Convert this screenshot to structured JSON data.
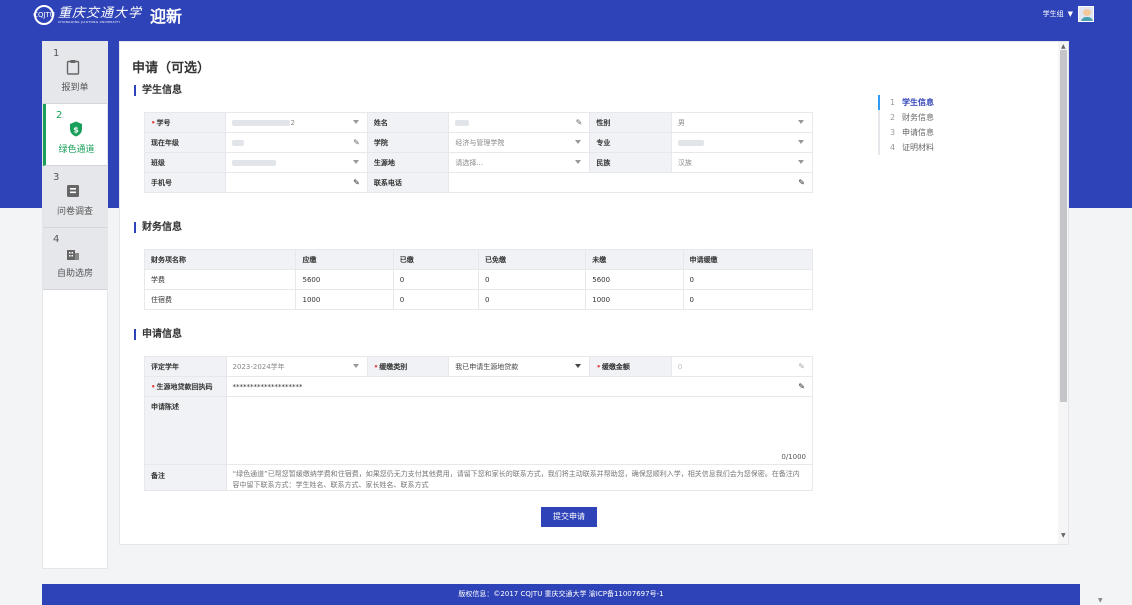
{
  "header": {
    "school_seal": "CQJTU",
    "school_name": "重庆交通大学",
    "school_name_en": "CHONGQING JIAOTONG UNIVERSITY",
    "app_title": "迎新",
    "user_label": "学生组"
  },
  "steps": [
    {
      "num": "1",
      "label": "报到单",
      "icon": "clipboard-icon",
      "active": false
    },
    {
      "num": "2",
      "label": "绿色通道",
      "icon": "shield-dollar-icon",
      "active": true
    },
    {
      "num": "3",
      "label": "问卷调查",
      "icon": "survey-icon",
      "active": false
    },
    {
      "num": "4",
      "label": "自助选房",
      "icon": "building-icon",
      "active": false
    }
  ],
  "main": {
    "title": "申请（可选）"
  },
  "student": {
    "section_title": "学生信息",
    "labels": {
      "id": "学号",
      "name": "姓名",
      "gender": "性别",
      "grade": "现在年级",
      "college": "学院",
      "major": "专业",
      "class": "班级",
      "origin": "生源地",
      "ethnic": "民族",
      "mobile": "手机号",
      "contact": "联系电话"
    },
    "values": {
      "id": "2",
      "gender": "男",
      "college": "经济与管理学院",
      "origin_placeholder": "请选择...",
      "ethnic": "汉族"
    }
  },
  "finance": {
    "section_title": "财务信息",
    "headers": [
      "财务项名称",
      "应缴",
      "已缴",
      "已免缴",
      "未缴",
      "申请缓缴"
    ],
    "rows": [
      [
        "学费",
        "5600",
        "0",
        "0",
        "5600",
        "0"
      ],
      [
        "住宿费",
        "1000",
        "0",
        "0",
        "1000",
        "0"
      ]
    ]
  },
  "apply": {
    "section_title": "申请信息",
    "labels": {
      "year": "评定学年",
      "type": "缓缴类别",
      "amount": "缓缴金额",
      "loan_code": "生源地贷款回执码",
      "statement": "申请陈述",
      "remark": "备注"
    },
    "values": {
      "year": "2023-2024学年",
      "type": "我已申请生源地贷款",
      "amount_placeholder": "0",
      "loan_code": "********************",
      "counter": "0/1000",
      "remark": "“绿色通道”已帮您暂缓缴纳学费和住宿费，如果您仍无力支付其他费用，请留下您和家长的联系方式，我们将主动联系并帮助您，确保您顺利入学，相关信息我们会为您保密。在备注内容中留下联系方式：学生姓名、联系方式、家长姓名、联系方式"
    },
    "submit_label": "提交申请"
  },
  "toc": [
    {
      "num": "1",
      "label": "学生信息",
      "active": true
    },
    {
      "num": "2",
      "label": "财务信息",
      "active": false
    },
    {
      "num": "3",
      "label": "申请信息",
      "active": false
    },
    {
      "num": "4",
      "label": "证明材料",
      "active": false
    }
  ],
  "footer": {
    "text": "版权信息：©2017 CQJTU 重庆交通大学 渝ICP备11007697号-1"
  },
  "colors": {
    "primary": "#2f43b8",
    "success": "#18a05a",
    "required": "#e54545"
  }
}
